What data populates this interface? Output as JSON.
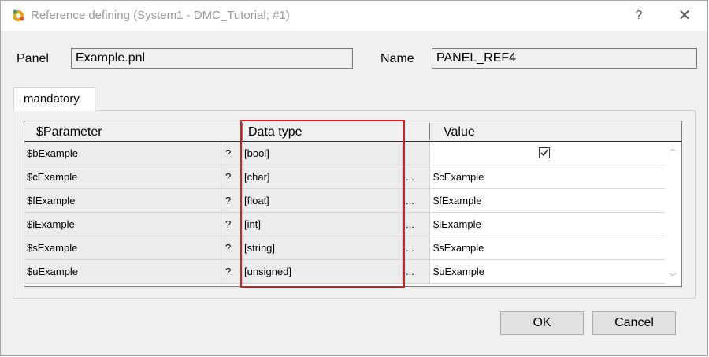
{
  "window": {
    "title": "Reference defining (System1 - DMC_Tutorial; #1)",
    "help_glyph": "?",
    "close_glyph": "✕"
  },
  "form": {
    "panel_label": "Panel",
    "panel_value": "Example.pnl",
    "name_label": "Name",
    "name_value": "PANEL_REF4"
  },
  "tabs": [
    {
      "label": "mandatory",
      "active": true
    }
  ],
  "table": {
    "headers": {
      "parameter": "$Parameter",
      "data_type": "Data type",
      "value": "Value"
    },
    "rows": [
      {
        "parameter": "$bExample",
        "help": "?",
        "data_type": "[bool]",
        "ellipsis": "",
        "value": "",
        "checkbox": true
      },
      {
        "parameter": "$cExample",
        "help": "?",
        "data_type": "[char]",
        "ellipsis": "...",
        "value": "$cExample"
      },
      {
        "parameter": "$fExample",
        "help": "?",
        "data_type": "[float]",
        "ellipsis": "...",
        "value": "$fExample"
      },
      {
        "parameter": "$iExample",
        "help": "?",
        "data_type": "[int]",
        "ellipsis": "...",
        "value": "$iExample"
      },
      {
        "parameter": "$sExample",
        "help": "?",
        "data_type": "[string]",
        "ellipsis": "...",
        "value": "$sExample"
      },
      {
        "parameter": "$uExample",
        "help": "?",
        "data_type": "[unsigned]",
        "ellipsis": "...",
        "value": "$uExample"
      }
    ]
  },
  "buttons": {
    "ok": "OK",
    "cancel": "Cancel"
  },
  "colors": {
    "highlight_border": "#d31f1f",
    "title_text": "#999999"
  },
  "icons": [
    "app-gear-icon",
    "help-icon",
    "close-icon",
    "checkbox-checked-icon",
    "scroll-up-icon",
    "scroll-down-icon"
  ]
}
